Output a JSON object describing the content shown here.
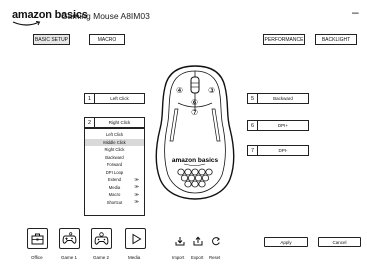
{
  "app": {
    "brand": "amazon basics",
    "title": "Gaming Mouse A8IM03",
    "minimize_label": "–"
  },
  "tabs": [
    {
      "label": "BASIC SETUP",
      "active": true
    },
    {
      "label": "MACRO",
      "active": false
    },
    {
      "label": "PERFORMANCE",
      "active": false
    },
    {
      "label": "BACKLIGHT",
      "active": false
    }
  ],
  "bindings": [
    {
      "num": "1",
      "label": "Left Click"
    },
    {
      "num": "2",
      "label": "Right Click"
    },
    {
      "num": "5",
      "label": "Backward"
    },
    {
      "num": "6",
      "label": "DPI+"
    },
    {
      "num": "7",
      "label": "DPI-"
    }
  ],
  "dropdown_items": [
    {
      "label": "Left Click",
      "arrow": ""
    },
    {
      "label": "Middle Click",
      "arrow": "",
      "highlight": true
    },
    {
      "label": "Right Click",
      "arrow": ""
    },
    {
      "label": "Backward",
      "arrow": ""
    },
    {
      "label": "Forward",
      "arrow": ""
    },
    {
      "label": "DPI Loop",
      "arrow": ""
    },
    {
      "label": "Extend",
      "arrow": "≫"
    },
    {
      "label": "Media",
      "arrow": "≫"
    },
    {
      "label": "Macro",
      "arrow": "≫"
    },
    {
      "label": "Shortcut",
      "arrow": "≫"
    }
  ],
  "mouse_labels": {
    "btn4": "④",
    "btn3": "③",
    "btn6": "⑥",
    "btn7": "⑦",
    "logo": "amazon basics"
  },
  "profiles": [
    {
      "label": "Office",
      "icon": "briefcase-icon"
    },
    {
      "label": "Game 1",
      "icon": "gamepad-icon"
    },
    {
      "label": "Game 2",
      "icon": "gamepad-gear-icon"
    },
    {
      "label": "Media",
      "icon": "play-icon"
    }
  ],
  "file_actions": [
    {
      "label": "Import",
      "icon": "import-icon"
    },
    {
      "label": "Export",
      "icon": "export-icon"
    },
    {
      "label": "Reset",
      "icon": "reset-icon"
    }
  ],
  "buttons": {
    "apply": "Apply",
    "cancel": "Cancel"
  }
}
